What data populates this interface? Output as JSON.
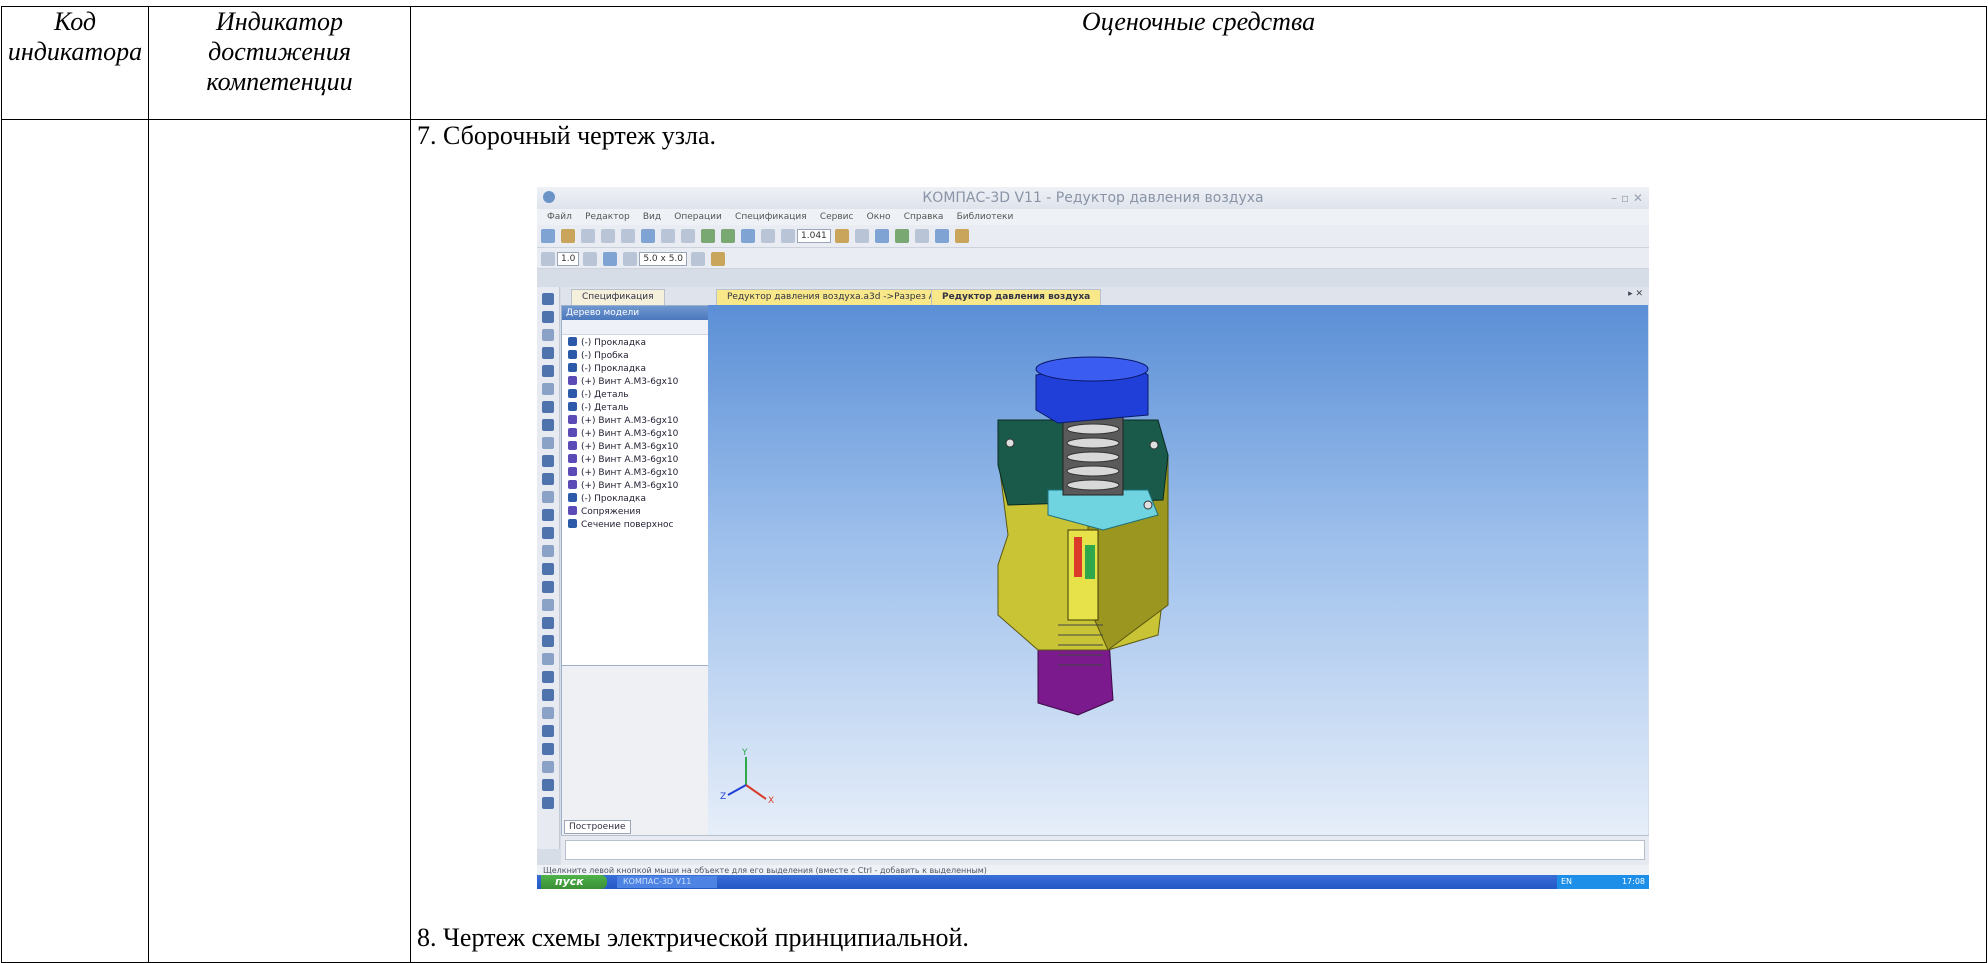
{
  "table": {
    "headers": [
      "Код индикатора",
      "Индикатор достижения компетенции",
      "Оценочные средства"
    ],
    "items": [
      "7. Сборочный чертеж узла.",
      "8. Чертеж схемы электрической принципиальной."
    ]
  },
  "screenshot": {
    "window_title": "КОМПАС-3D V11 - Редуктор давления воздуха",
    "menu": [
      "Файл",
      "Редактор",
      "Вид",
      "Операции",
      "Спецификация",
      "Сервис",
      "Окно",
      "Справка",
      "Библиотеки"
    ],
    "toolbar": {
      "zoom": "1.041",
      "step": "1.0",
      "grid": "5.0 x 5.0"
    },
    "tabs": [
      "Спецификация",
      "Редуктор давления воздуха.a3d ->Разрез А-А",
      "Редуктор давления воздуха"
    ],
    "tree_title": "Дерево модели",
    "tree_items": [
      "(-) Прокладка",
      "(-) Пробка",
      "(-) Прокладка",
      "(+) Винт А.М3-6gx10",
      "(-) Деталь",
      "(-) Деталь",
      "(+) Винт А.М3-6gx10",
      "(+) Винт А.М3-6gx10",
      "(+) Винт А.М3-6gx10",
      "(+) Винт А.М3-6gx10",
      "(+) Винт А.М3-6gx10",
      "(+) Винт А.М3-6gx10",
      "(-) Прокладка",
      "Сопряжения",
      "Сечение поверхнос"
    ],
    "tree_tab": "Построение",
    "status": "Щелкните левой кнопкой мыши на объекте для его выделения (вместе с Ctrl - добавить к выделенным)",
    "start_label": "пуск",
    "task_label": "КОМПАС-3D V11",
    "tray": {
      "lang": "EN",
      "time": "17:08"
    },
    "axis_labels": [
      "Y",
      "X",
      "Z"
    ],
    "colors": {
      "body": "#c9c436",
      "cap": "#1f3fd8",
      "cover": "#1a5a4a",
      "bottom": "#7a1a8c",
      "spring": "#d8d8d8"
    }
  }
}
